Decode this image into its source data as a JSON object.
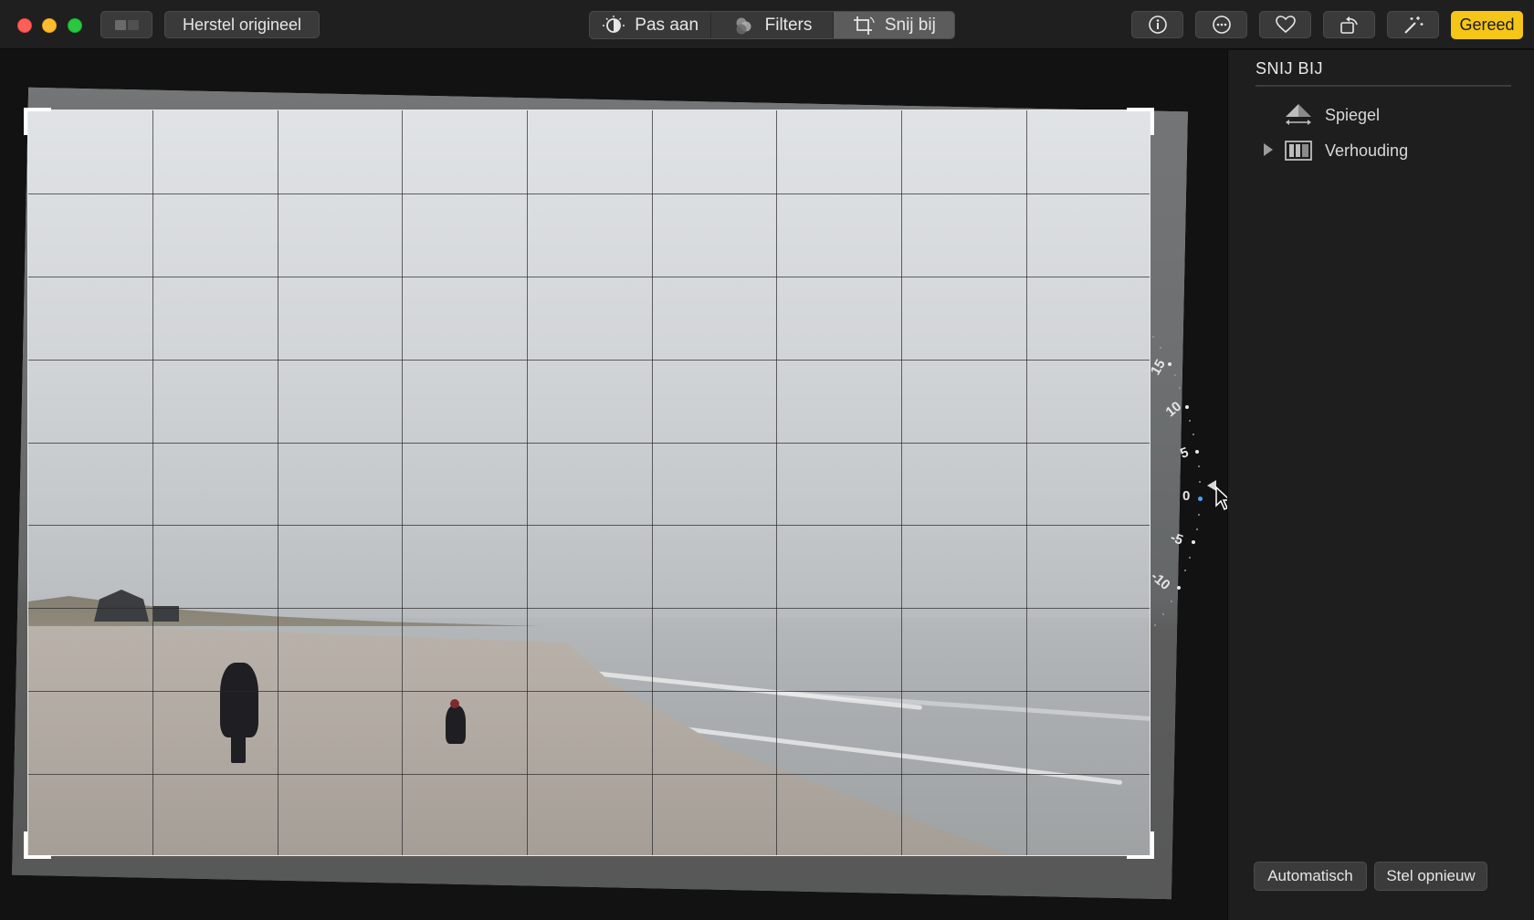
{
  "toolbar": {
    "revert_label": "Herstel origineel",
    "tabs": [
      {
        "label": "Pas aan",
        "icon": "adjust-icon",
        "active": false
      },
      {
        "label": "Filters",
        "icon": "filters-icon",
        "active": false
      },
      {
        "label": "Snij bij",
        "icon": "crop-icon",
        "active": true
      }
    ],
    "action_icons": [
      "info-icon",
      "more-icon",
      "heart-icon",
      "rotate-icon",
      "magic-wand-icon"
    ],
    "done_label": "Gereed",
    "done_color": "#f5c518"
  },
  "dial": {
    "labels": [
      "15",
      "10",
      "5",
      "0",
      "-5",
      "-10"
    ],
    "current_value": 0,
    "current_color": "#4aa3ff"
  },
  "sidebar": {
    "title": "SNIJ BIJ",
    "items": [
      {
        "label": "Spiegel",
        "icon": "flip-icon"
      },
      {
        "label": "Verhouding",
        "icon": "aspect-ratio-icon",
        "disclosure": true
      }
    ],
    "buttons": {
      "auto_label": "Automatisch",
      "reset_label": "Stel opnieuw"
    }
  }
}
